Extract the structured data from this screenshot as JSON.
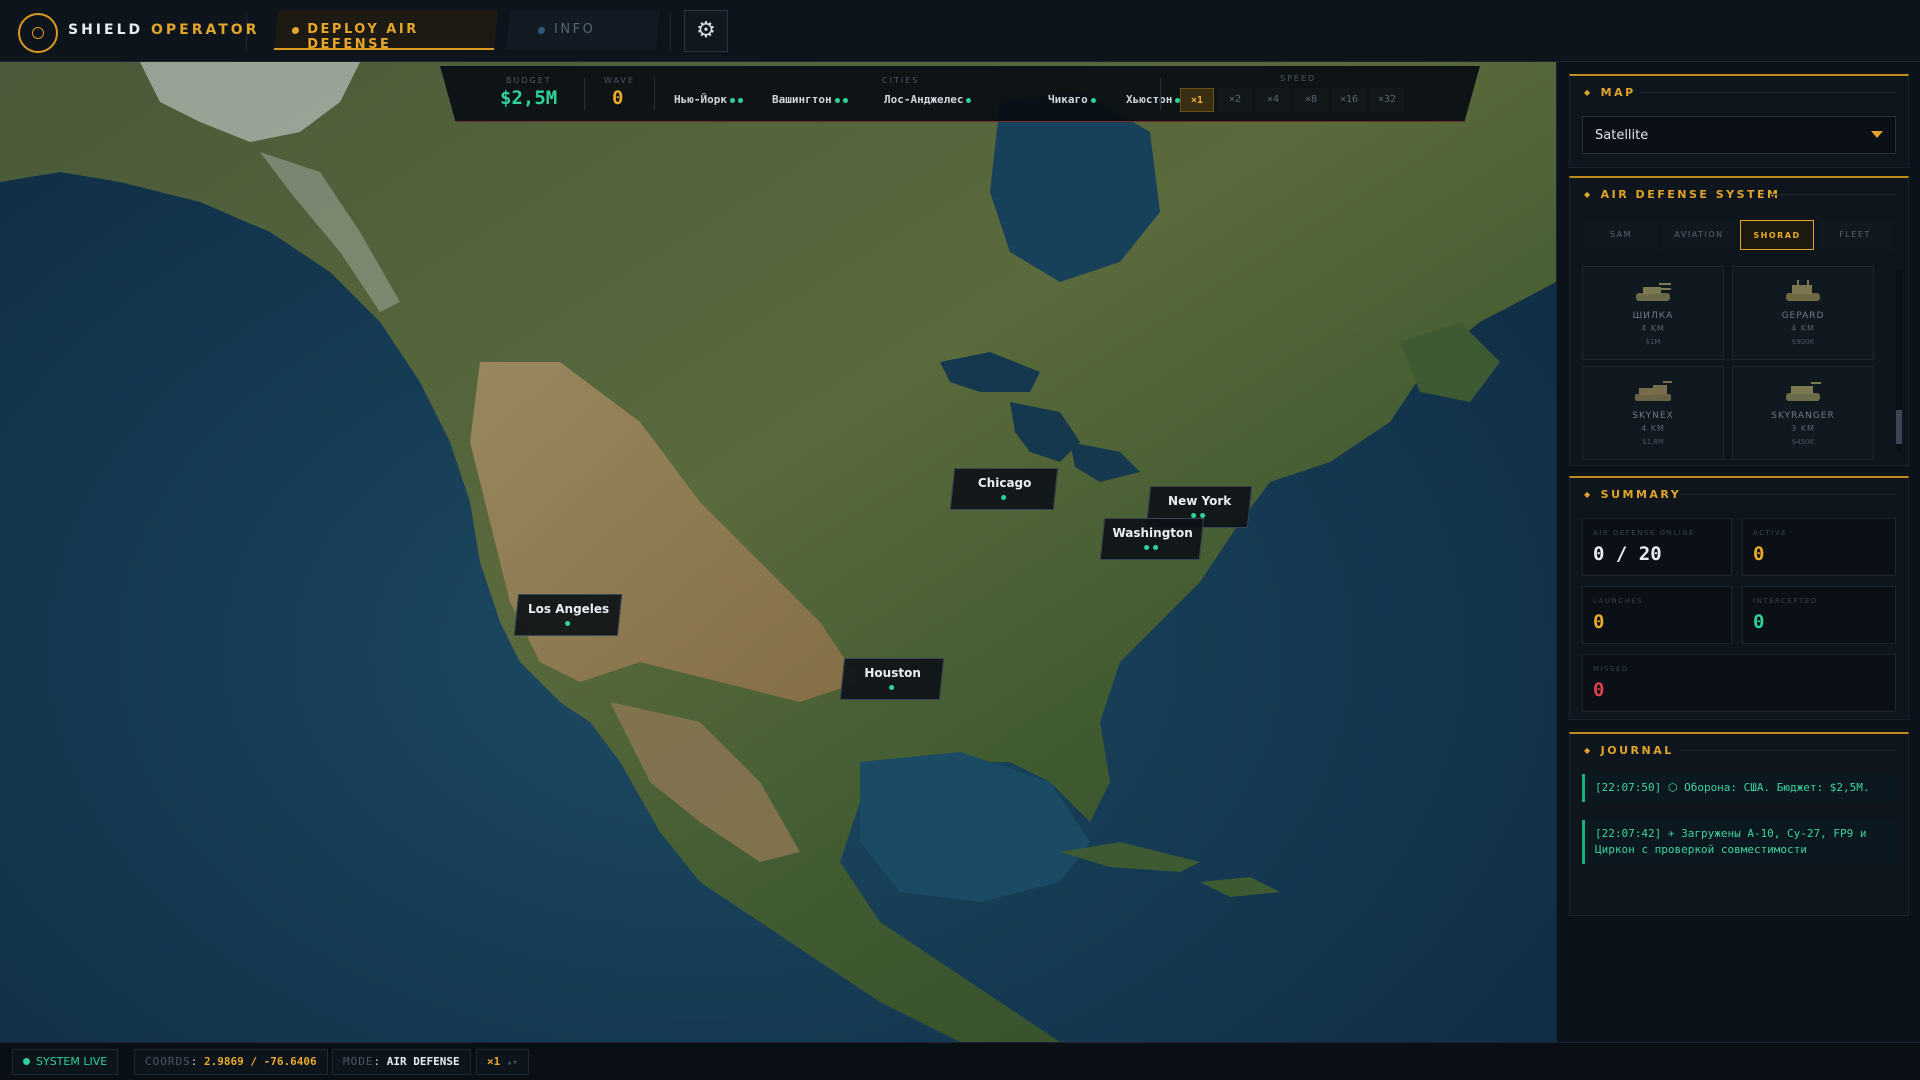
{
  "app": {
    "title_main": "SHIELD",
    "title_accent": "OPERATOR"
  },
  "topbar": {
    "deploy_label": "DEPLOY AIR DEFENSE",
    "info_label": "INFO",
    "settings_icon": "gear-icon"
  },
  "hud": {
    "budget_caption": "BUDGET",
    "budget_value": "$2,5M",
    "wave_caption": "WAVE",
    "wave_value": "0",
    "cities_caption": "CITIES",
    "cities": [
      {
        "name": "Нью-Йорк",
        "health": 2
      },
      {
        "name": "Вашингтон",
        "health": 2
      },
      {
        "name": "Лос-Анджелес",
        "health": 1
      },
      {
        "name": "Чикаго",
        "health": 1
      },
      {
        "name": "Хьюстон",
        "health": 1
      }
    ],
    "speed_caption": "SPEED",
    "speeds": [
      "×1",
      "×2",
      "×4",
      "×8",
      "×16",
      "×32"
    ],
    "speed_active": "×1"
  },
  "map_cities": [
    {
      "name": "Chicago",
      "dots": 1
    },
    {
      "name": "New York",
      "dots": 2
    },
    {
      "name": "Washington",
      "dots": 2
    },
    {
      "name": "Los Angeles",
      "dots": 1
    },
    {
      "name": "Houston",
      "dots": 1
    }
  ],
  "panel": {
    "map_section": {
      "title": "MAP",
      "selected": "Satellite"
    },
    "ad_section": {
      "title": "AIR DEFENSE SYSTEM",
      "tabs": [
        "SAM",
        "AVIATION",
        "SHORAD",
        "FLEET"
      ],
      "active_tab": "SHORAD",
      "units": [
        {
          "name": "ШИЛКА",
          "range": "4 KM",
          "price": "$1M"
        },
        {
          "name": "GEPARD",
          "range": "4 KM",
          "price": "$900K"
        },
        {
          "name": "SKYNEX",
          "range": "4 KM",
          "price": "$1,8M"
        },
        {
          "name": "SKYRANGER",
          "range": "3 KM",
          "price": "$450K"
        }
      ]
    },
    "summary": {
      "title": "SUMMARY",
      "online_caption": "AIR DEFENSE ONLINE",
      "online_value": "0 / 20",
      "active_caption": "ACTIVE",
      "active_value": "0",
      "launches_caption": "LAUNCHES",
      "launches_value": "0",
      "intercepted_caption": "INTERCEPTED",
      "intercepted_value": "0",
      "missed_caption": "MISSED",
      "missed_value": "0"
    },
    "journal": {
      "title": "JOURNAL",
      "entries": [
        "[22:07:50] ⬡ Оборона: США. Бюджет: $2,5M.",
        "[22:07:42] ✈ Загружены A-10, Су-27, FP9 и Циркон с проверкой совместимости"
      ]
    }
  },
  "statusbar": {
    "live_label": "SYSTEM LIVE",
    "coords_caption": "COORDS",
    "coords_value": "2.9869 / -76.6406",
    "mode_caption": "MODE",
    "mode_value": "AIR DEFENSE",
    "speed_value": "×1"
  },
  "colors": {
    "accent": "#e0a52a",
    "positive": "#2fd39a",
    "negative": "#e0404a",
    "panel_bg": "#0c1219"
  }
}
